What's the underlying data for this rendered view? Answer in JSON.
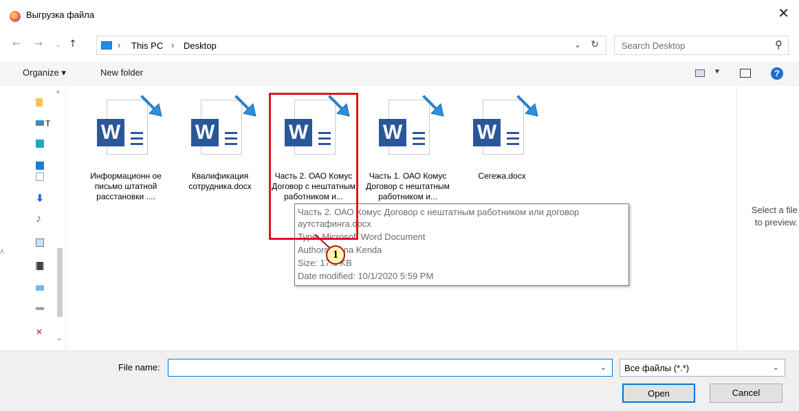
{
  "window": {
    "title": "Выгрузка файла",
    "close_icon": "close-icon"
  },
  "nav": {
    "back_icon": "←",
    "forward_icon": "→",
    "recent_icon": "⌄",
    "up_icon": "↑",
    "crumb_sep": "›",
    "breadcrumbs": [
      "This PC",
      "Desktop"
    ],
    "address_dropdown": "⌄",
    "refresh_icon": "↻",
    "search_placeholder": "Search Desktop",
    "search_icon": "⚲"
  },
  "toolbar": {
    "organize": "Organize ▾",
    "new_folder": "New folder",
    "help": "?"
  },
  "sidebar": {
    "partial_label": "T",
    "left_edge": "A",
    "scroll_up": "^",
    "scroll_down": "⌄"
  },
  "files": [
    {
      "label": "Информационн ое письмо штатной расстановки ...."
    },
    {
      "label": "Квалификация сотрудника.docx"
    },
    {
      "label": "Часть 2. ОАО Комус Договор с нештатным работником и..."
    },
    {
      "label": "Часть 1. ОАО Комус Договор с нештатным работником и..."
    },
    {
      "label": "Сегежа.docx"
    }
  ],
  "tooltip": {
    "lines": [
      "Часть 2. ОАО Комус Договор с нештатным работником или договор",
      "аутстафинга.docx",
      "Type: Microsoft Word Document",
      "Authors: Yana Kenda",
      "Size: 17.6 KB",
      "Date modified: 10/1/2020 5:59 PM"
    ]
  },
  "callout": {
    "number": "1"
  },
  "highlight_color": "#e0141e",
  "preview": {
    "message": "Select a file to preview."
  },
  "bottom": {
    "file_name_label": "File name:",
    "file_name_value": "",
    "dropdown": "⌄",
    "filter_value": "Все файлы (*.*)",
    "open": "Open",
    "cancel": "Cancel",
    "grip": "⋰"
  }
}
